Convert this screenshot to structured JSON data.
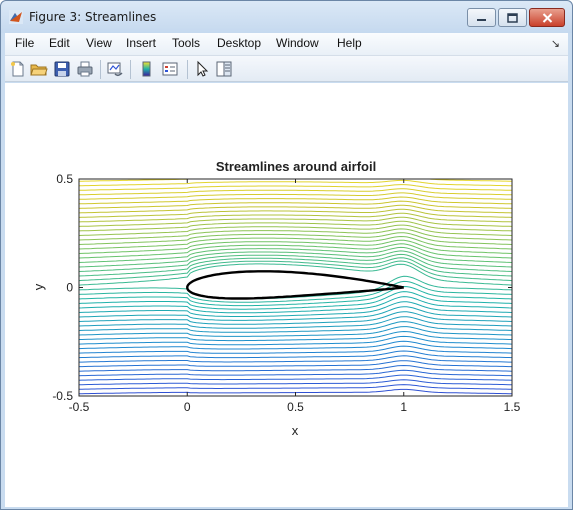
{
  "window": {
    "title": "Figure 3: Streamlines",
    "icon": "matlab-icon",
    "controls": [
      "minimize-icon",
      "maximize-icon",
      "close-icon"
    ]
  },
  "menu": {
    "items": [
      "File",
      "Edit",
      "View",
      "Insert",
      "Tools",
      "Desktop",
      "Window",
      "Help"
    ],
    "dock_arrow": "↘"
  },
  "toolbar": {
    "buttons": [
      "new-figure-icon",
      "open-file-icon",
      "save-icon",
      "print-icon",
      "link-plot-icon",
      "colorbar-icon",
      "legend-icon",
      "pointer-icon",
      "property-editor-icon"
    ]
  },
  "chart_data": {
    "type": "line",
    "title": "Streamlines around airfoil",
    "xlabel": "x",
    "ylabel": "y",
    "xlim": [
      -0.5,
      1.5
    ],
    "ylim": [
      -0.5,
      0.5
    ],
    "xticks": [
      "-0.5",
      "0",
      "0.5",
      "1",
      "1.5"
    ],
    "yticks": [
      "-0.5",
      "0",
      "0.5"
    ],
    "grid": false,
    "colormap": [
      "#3e1a9e",
      "#2f54d6",
      "#1f8bd0",
      "#1fb3a8",
      "#6cc36a",
      "#c9c330",
      "#f7e22b"
    ],
    "airfoil_outline_color": "#000000"
  }
}
